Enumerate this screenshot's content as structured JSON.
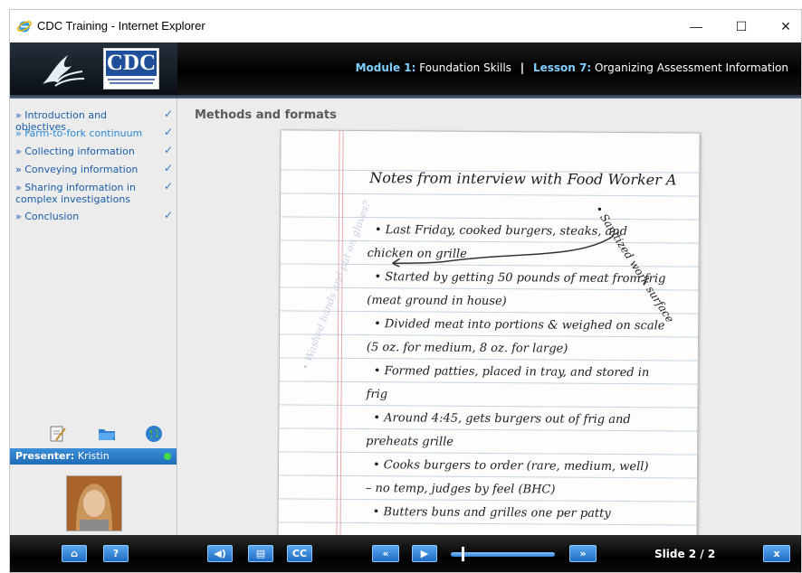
{
  "window": {
    "title": "CDC Training - Internet Explorer",
    "minimize_label": "—",
    "maximize_label": "☐",
    "close_label": "✕"
  },
  "header": {
    "logo_text": "CDC",
    "module_key": "Module 1:",
    "module_name": "Foundation Skills",
    "separator": "|",
    "lesson_key": "Lesson 7:",
    "lesson_name": "Organizing Assessment Information"
  },
  "sidebar": {
    "items": [
      {
        "label": "» Introduction and objectives",
        "check": "✓"
      },
      {
        "label": "» Farm-to-fork continuum",
        "check": "✓"
      },
      {
        "label": "» Collecting information",
        "check": "✓"
      },
      {
        "label": "» Conveying information",
        "check": "✓"
      },
      {
        "label": "» Sharing information in complex investigations",
        "check": "✓"
      },
      {
        "label": "» Conclusion",
        "check": "✓"
      }
    ],
    "icons": [
      "notes-icon",
      "folder-icon",
      "globe-icon"
    ],
    "presenter_label": "Presenter:",
    "presenter_name": "Kristin"
  },
  "main": {
    "section_title": "Methods and formats",
    "notebook": {
      "title": "Notes from interview with Food Worker A",
      "lines": [
        "• Last Friday, cooked burgers, steaks, and",
        "chicken on grille",
        "• Started by getting 50 pounds of meat from frig",
        "(meat ground in house)",
        "• Divided meat into portions & weighed on scale",
        "(5 oz. for medium, 8 oz. for large)",
        "• Formed patties, placed in tray, and stored in",
        "frig",
        "• Around 4:45, gets burgers out of frig and",
        "preheats grille",
        "• Cooks burgers to order (rare, medium, well)",
        "– no temp, judges by feel (BHC)",
        "• Butters buns and grilles one per patty"
      ],
      "side_note": "• Sanitized work surface",
      "faint_note": "• Washed hands and put on gloves?"
    }
  },
  "toolbar": {
    "home_label": "⌂",
    "help_label": "?",
    "audio_label": "◀)",
    "notes_label": "▤",
    "cc_label": "CC",
    "prev_label": "«",
    "play_label": "▶",
    "next_label": "»",
    "slide_counter": "Slide 2 / 2",
    "exit_label": "x",
    "progress_fraction": 0.1
  },
  "colors": {
    "accent": "#2a7bc4",
    "header_key": "#7fd0ff",
    "presenter_bar": "#2f7fd0",
    "status_dot": "#41d94a"
  }
}
